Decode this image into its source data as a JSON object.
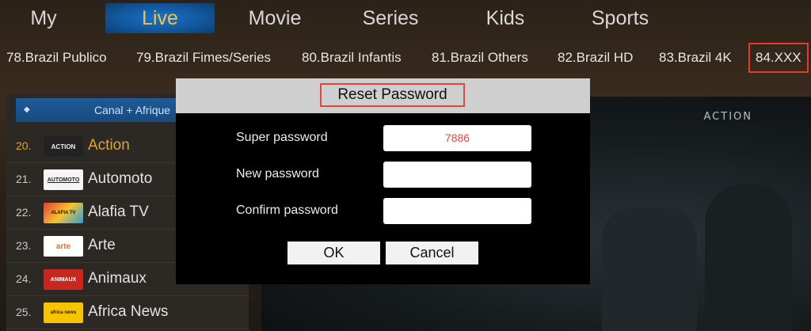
{
  "nav": {
    "tabs": [
      "My",
      "Live",
      "Movie",
      "Series",
      "Kids",
      "Sports"
    ],
    "active": "Live"
  },
  "categories": [
    "78.Brazil Publico",
    "79.Brazil Fimes/Series",
    "80.Brazil Infantis",
    "81.Brazil Others",
    "82.Brazil HD",
    "83.Brazil 4K",
    "84.XXX"
  ],
  "channel_list": {
    "header": "Canal + Afrique",
    "channels": [
      {
        "num": "20.",
        "name": "Action",
        "logo": "ACTION"
      },
      {
        "num": "21.",
        "name": "Automoto",
        "logo": "AUTOMOTO"
      },
      {
        "num": "22.",
        "name": "Alafia TV",
        "logo": "ALAFIA TV"
      },
      {
        "num": "23.",
        "name": "Arte",
        "logo": "arte"
      },
      {
        "num": "24.",
        "name": "Animaux",
        "logo": "ANIMAUX"
      },
      {
        "num": "25.",
        "name": "Africa News",
        "logo": "africa news"
      }
    ]
  },
  "preview": {
    "brand": "ACTION"
  },
  "dialog": {
    "title": "Reset Password",
    "super_label": "Super password",
    "super_value": "7886",
    "new_label": "New password",
    "new_value": "",
    "confirm_label": "Confirm password",
    "confirm_value": "",
    "ok": "OK",
    "cancel": "Cancel"
  },
  "colors": {
    "accent_red": "#e53b2f",
    "active_tab": "#1a72c9",
    "current_channel": "#e0a23a"
  }
}
